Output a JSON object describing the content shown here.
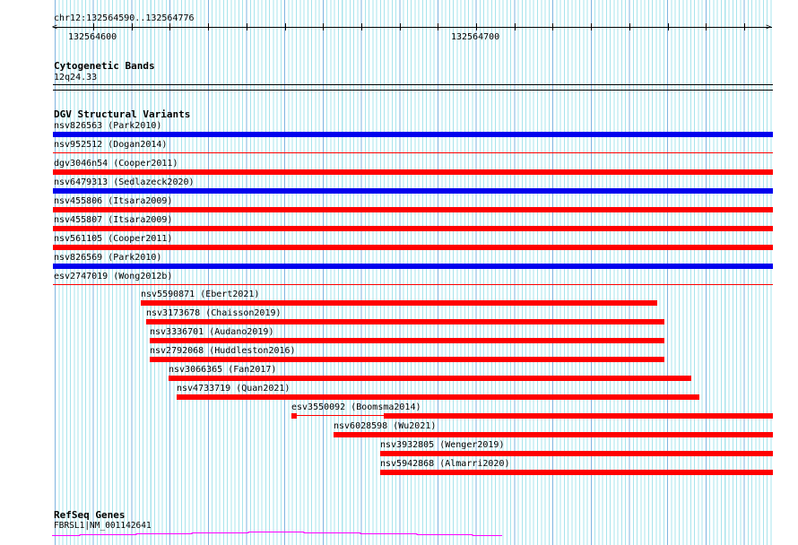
{
  "ruler": {
    "range": "chr12:132564590..132564776",
    "tick_labels": [
      "132564600",
      "132564700"
    ]
  },
  "cyto": {
    "title": "Cytogenetic Bands",
    "band": "12q24.33"
  },
  "dgv": {
    "title": "DGV Structural Variants",
    "items": [
      "nsv826563 (Park2010)",
      "nsv952512 (Dogan2014)",
      "dgv3046n54 (Cooper2011)",
      "nsv6479313 (Sedlazeck2020)",
      "nsv455806 (Itsara2009)",
      "nsv455807 (Itsara2009)",
      "nsv561105 (Cooper2011)",
      "nsv826569 (Park2010)",
      "esv2747019 (Wong2012b)",
      "nsv5590871 (Ebert2021)",
      "nsv3173678 (Chaisson2019)",
      "nsv3336701 (Audano2019)",
      "nsv2792068 (Huddleston2016)",
      "nsv3066365 (Fan2017)",
      "nsv4733719 (Quan2021)",
      "esv3550092 (Boomsma2014)",
      "nsv6028598 (Wu2021)",
      "nsv3932805 (Wenger2019)",
      "nsv5942868 (Almarri2020)"
    ]
  },
  "refseq": {
    "title": "RefSeq Genes",
    "gene": "FBRSL1|NM_001142641"
  },
  "colors": {
    "gain": "#0000ee",
    "loss": "#ff0000",
    "gene": "#ff00ff"
  }
}
